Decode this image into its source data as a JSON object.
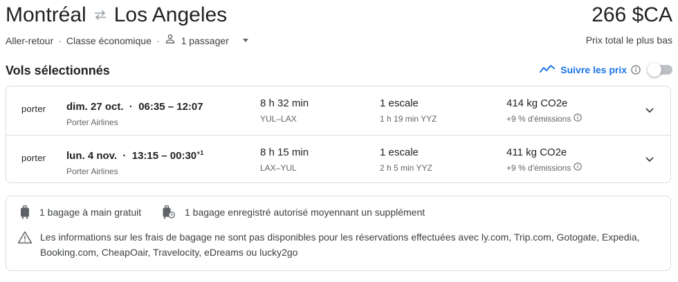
{
  "header": {
    "origin": "Montréal",
    "destination": "Los Angeles",
    "swap_icon": "swap-arrows-icon",
    "price": "266 $CA",
    "price_caption": "Prix total le plus bas",
    "trip_type": "Aller-retour",
    "cabin_class": "Classe économique",
    "passengers": "1 passager"
  },
  "section": {
    "title": "Vols sélectionnés",
    "track_label": "Suivre les prix",
    "track_enabled": false
  },
  "flights": [
    {
      "airline_logo": "porter",
      "date": "dim. 27 oct.",
      "times": "06:35 – 12:07",
      "day_offset": "",
      "airline": "Porter Airlines",
      "duration": "8 h 32 min",
      "route": "YUL–LAX",
      "stops": "1 escale",
      "layover": "1 h 19 min YYZ",
      "emissions": "414 kg CO2e",
      "emissions_delta": "+9 % d'émissions"
    },
    {
      "airline_logo": "porter",
      "date": "lun. 4 nov.",
      "times": "13:15 – 00:30",
      "day_offset": "+1",
      "airline": "Porter Airlines",
      "duration": "8 h 15 min",
      "route": "LAX–YUL",
      "stops": "1 escale",
      "layover": "2 h 5 min YYZ",
      "emissions": "411 kg CO2e",
      "emissions_delta": "+9 % d'émissions"
    }
  ],
  "baggage": {
    "carry_on": "1 bagage à main gratuit",
    "checked": "1 bagage enregistré autorisé moyennant un supplément",
    "notice": "Les informations sur les frais de bagage ne sont pas disponibles pour les réservations effectuées avec ly.com, Trip.com, Gotogate, Expedia, Booking.com, CheapOair, Travelocity, eDreams ou lucky2go"
  },
  "colors": {
    "accent": "#1a73e8",
    "text": "#202124",
    "secondary": "#5f6368",
    "border": "#dadce0"
  }
}
